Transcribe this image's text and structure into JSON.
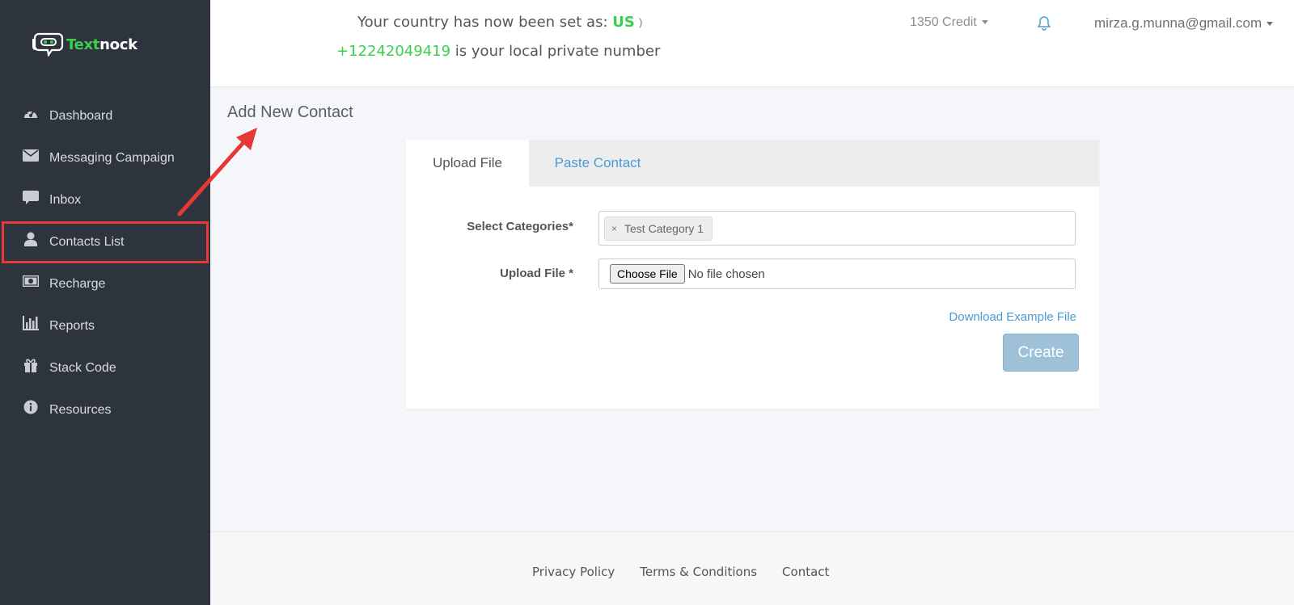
{
  "brand": {
    "part1": "Text",
    "part2": "nock",
    "icon": "chat-bot-logo-icon"
  },
  "sidebar": {
    "items": [
      {
        "label": "Dashboard",
        "icon": "dashboard-gauge-icon"
      },
      {
        "label": "Messaging Campaign",
        "icon": "envelope-icon"
      },
      {
        "label": "Inbox",
        "icon": "chat-bubble-icon"
      },
      {
        "label": "Contacts List",
        "icon": "user-icon",
        "highlighted": true
      },
      {
        "label": "Recharge",
        "icon": "money-icon"
      },
      {
        "label": "Reports",
        "icon": "bar-chart-icon"
      },
      {
        "label": "Stack Code",
        "icon": "gift-icon"
      },
      {
        "label": "Resources",
        "icon": "info-circle-icon"
      }
    ]
  },
  "header": {
    "country_text": "Your country has now been set as:",
    "country_code": "US",
    "paren": ")",
    "phone": "+12242049419",
    "phone_text": "is your local private number",
    "credit": "1350 Credit",
    "user_email": "mirza.g.munna@gmail.com"
  },
  "main": {
    "title": "Add New Contact",
    "tabs": [
      {
        "label": "Upload File",
        "active": true
      },
      {
        "label": "Paste Contact",
        "active": false
      }
    ],
    "form": {
      "categories_label": "Select Categories*",
      "category_chip": "Test Category 1",
      "chip_remove": "×",
      "upload_label": "Upload File *",
      "choose_button": "Choose File",
      "no_file": "No file chosen",
      "download_link": "Download Example File",
      "create_button": "Create"
    }
  },
  "footer": {
    "links": [
      "Privacy Policy",
      "Terms & Conditions",
      "Contact"
    ]
  },
  "colors": {
    "sidebar_bg": "#2e343e",
    "accent_green": "#3ccf4e",
    "link_blue": "#4a9bd6",
    "highlight_red": "#e53935",
    "create_button": "#9ec1d8"
  }
}
